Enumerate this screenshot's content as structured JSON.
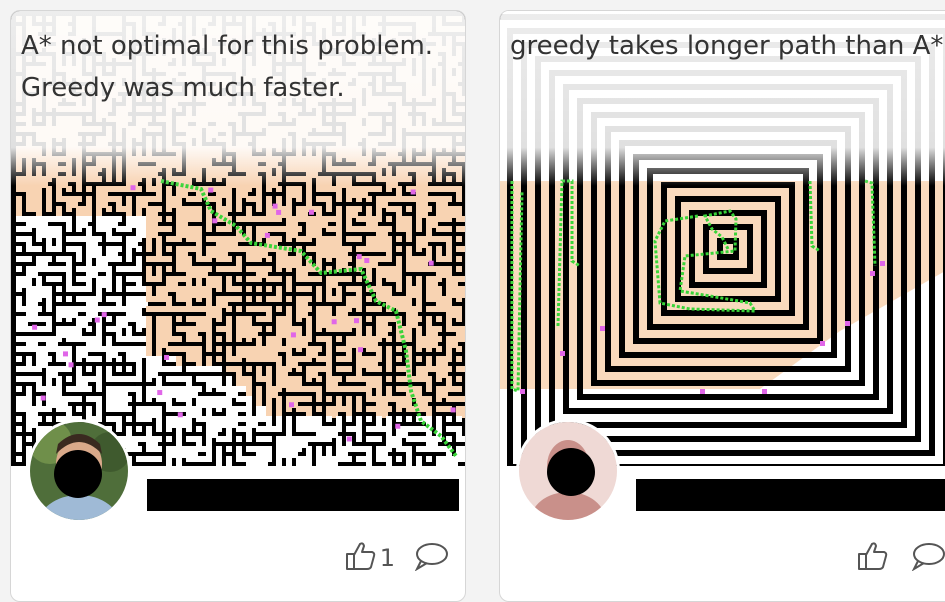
{
  "cards": [
    {
      "caption": "A* not optimal for this problem.\nGreedy was much faster.",
      "like_count": "1",
      "like_icon": "thumbs-up-icon",
      "comment_icon": "comment-icon",
      "colors": {
        "explored": "#f8d3b2",
        "path": "#39d439",
        "frontier": "#e066e8",
        "wall": "#000000"
      }
    },
    {
      "caption": "greedy takes longer path than A*",
      "like_count": "",
      "like_icon": "thumbs-up-icon",
      "comment_icon": "comment-icon",
      "colors": {
        "explored": "#f8d3b2",
        "path": "#39d439",
        "frontier": "#e066e8",
        "wall": "#000000"
      }
    }
  ]
}
